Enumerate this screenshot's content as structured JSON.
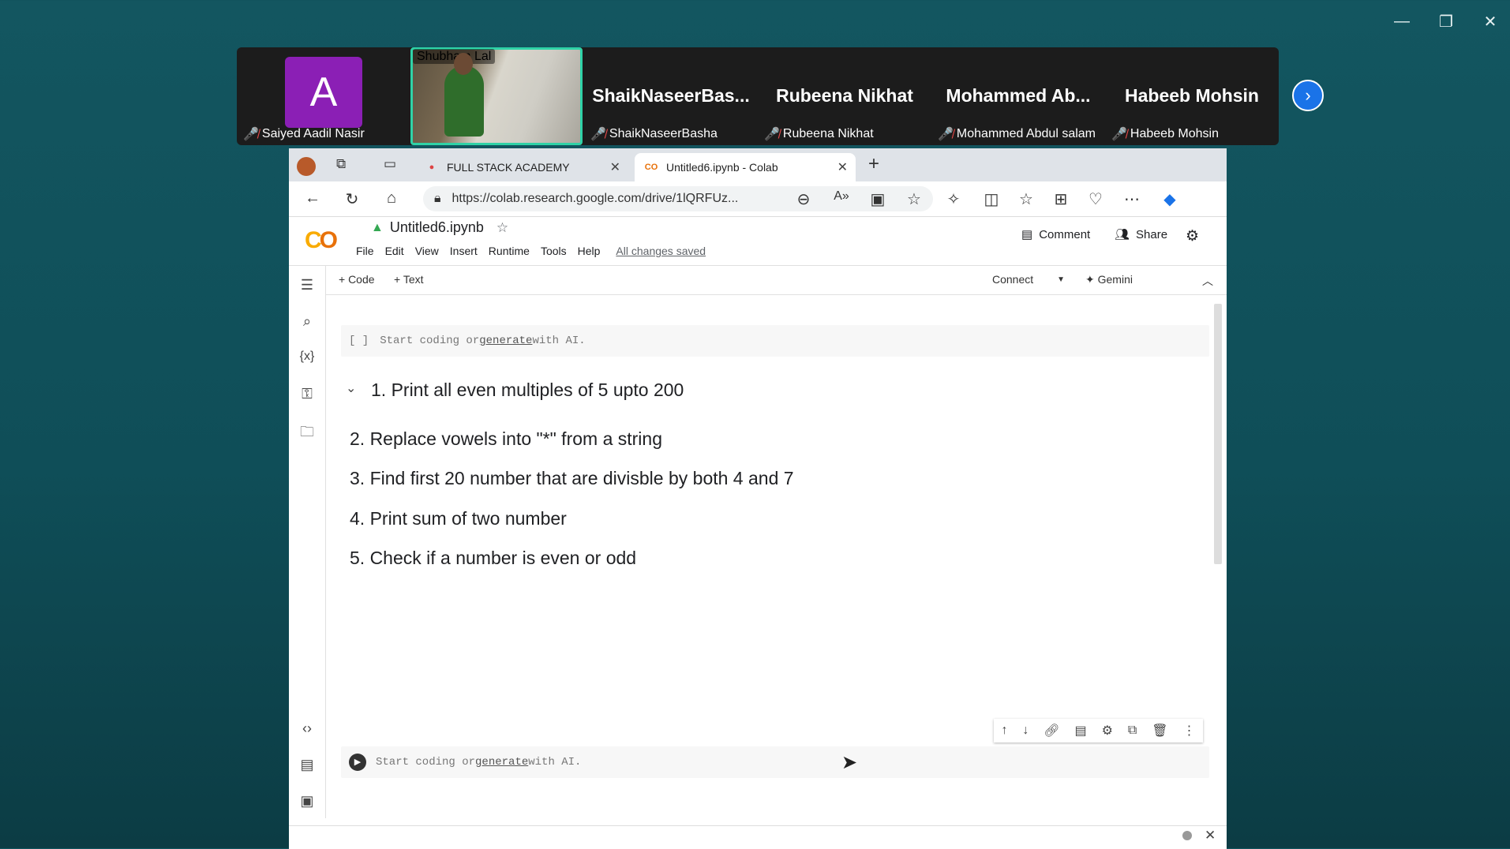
{
  "window_controls": {
    "minimize": "—",
    "restore": "❐",
    "close": "✕"
  },
  "participants": [
    {
      "big_name": "",
      "initial": "A",
      "label": "Saiyed Aadil Nasir"
    },
    {
      "big_name": "",
      "label": "Shubham Lal"
    },
    {
      "big_name": "ShaikNaseerBas...",
      "label": "ShaikNaseerBasha"
    },
    {
      "big_name": "Rubeena Nikhat",
      "label": "Rubeena Nikhat"
    },
    {
      "big_name": "Mohammed  Ab...",
      "label": "Mohammed Abdul salam"
    },
    {
      "big_name": "Habeeb Mohsin",
      "label": "Habeeb Mohsin"
    }
  ],
  "next_icon": "›",
  "browser": {
    "tabs": [
      {
        "label": "FULL STACK ACADEMY",
        "close": "✕"
      },
      {
        "label": "Untitled6.ipynb - Colab",
        "close": "✕"
      }
    ],
    "new_tab": "+",
    "url": "https://colab.research.google.com/drive/1lQRFUz..."
  },
  "colab": {
    "title": "Untitled6.ipynb",
    "menus": [
      "File",
      "Edit",
      "View",
      "Insert",
      "Runtime",
      "Tools",
      "Help"
    ],
    "saved_status": "All changes saved",
    "comment_label": "Comment",
    "share_label": "Share",
    "toolbar": {
      "code": "+ Code",
      "text": "+ Text",
      "connect": "Connect",
      "gemini": "✦ Gemini"
    },
    "cell1": {
      "bracket": "[ ]",
      "prefix": "Start coding or ",
      "link": "generate",
      "suffix": " with AI."
    },
    "markdown": [
      "1. Print all even multiples of 5 upto 200",
      "2. Replace vowels into \"*\" from a string",
      "3. Find first 20 number that are divisble by both 4 and 7",
      "4. Print sum of two number",
      "5. Check if a number is even or odd"
    ],
    "cell2": {
      "prefix": "Start coding or ",
      "link": "generate",
      "suffix": " with AI."
    }
  }
}
